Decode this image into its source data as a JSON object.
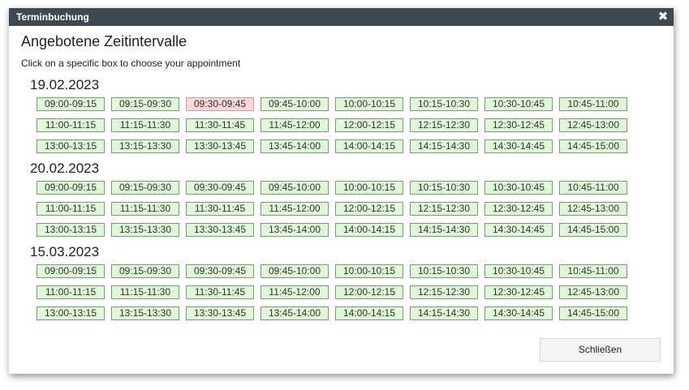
{
  "dialog": {
    "title": "Terminbuchung",
    "close_icon": "close-icon",
    "heading": "Angebotene Zeitintervalle",
    "hint": "Click on a specific box to choose your appointment",
    "close_button_label": "Schließen"
  },
  "colors": {
    "titlebar": "#3d4a54",
    "slot_available": "#dff8d8",
    "slot_available_border": "#7a9a76",
    "slot_booked": "#f9d7d7"
  },
  "days": [
    {
      "date": "19.02.2023",
      "slots": [
        {
          "label": "09:00-09:15",
          "state": "available"
        },
        {
          "label": "09:15-09:30",
          "state": "available"
        },
        {
          "label": "09:30-09:45",
          "state": "booked"
        },
        {
          "label": "09:45-10:00",
          "state": "available"
        },
        {
          "label": "10:00-10:15",
          "state": "available"
        },
        {
          "label": "10:15-10:30",
          "state": "available"
        },
        {
          "label": "10:30-10:45",
          "state": "available"
        },
        {
          "label": "10:45-11:00",
          "state": "available"
        },
        {
          "label": "11:00-11:15",
          "state": "available"
        },
        {
          "label": "11:15-11:30",
          "state": "available"
        },
        {
          "label": "11:30-11:45",
          "state": "available"
        },
        {
          "label": "11:45-12:00",
          "state": "available"
        },
        {
          "label": "12:00-12:15",
          "state": "available"
        },
        {
          "label": "12:15-12:30",
          "state": "available"
        },
        {
          "label": "12:30-12:45",
          "state": "available"
        },
        {
          "label": "12:45-13:00",
          "state": "available"
        },
        {
          "label": "13:00-13:15",
          "state": "available"
        },
        {
          "label": "13:15-13:30",
          "state": "available"
        },
        {
          "label": "13:30-13:45",
          "state": "available"
        },
        {
          "label": "13:45-14:00",
          "state": "available"
        },
        {
          "label": "14:00-14:15",
          "state": "available"
        },
        {
          "label": "14:15-14:30",
          "state": "available"
        },
        {
          "label": "14:30-14:45",
          "state": "available"
        },
        {
          "label": "14:45-15:00",
          "state": "available"
        }
      ]
    },
    {
      "date": "20.02.2023",
      "slots": [
        {
          "label": "09:00-09:15",
          "state": "available"
        },
        {
          "label": "09:15-09:30",
          "state": "available"
        },
        {
          "label": "09:30-09:45",
          "state": "available"
        },
        {
          "label": "09:45-10:00",
          "state": "available"
        },
        {
          "label": "10:00-10:15",
          "state": "available"
        },
        {
          "label": "10:15-10:30",
          "state": "available"
        },
        {
          "label": "10:30-10:45",
          "state": "available"
        },
        {
          "label": "10:45-11:00",
          "state": "available"
        },
        {
          "label": "11:00-11:15",
          "state": "available"
        },
        {
          "label": "11:15-11:30",
          "state": "available"
        },
        {
          "label": "11:30-11:45",
          "state": "available"
        },
        {
          "label": "11:45-12:00",
          "state": "available"
        },
        {
          "label": "12:00-12:15",
          "state": "available"
        },
        {
          "label": "12:15-12:30",
          "state": "available"
        },
        {
          "label": "12:30-12:45",
          "state": "available"
        },
        {
          "label": "12:45-13:00",
          "state": "available"
        },
        {
          "label": "13:00-13:15",
          "state": "available"
        },
        {
          "label": "13:15-13:30",
          "state": "available"
        },
        {
          "label": "13:30-13:45",
          "state": "available"
        },
        {
          "label": "13:45-14:00",
          "state": "available"
        },
        {
          "label": "14:00-14:15",
          "state": "available"
        },
        {
          "label": "14:15-14:30",
          "state": "available"
        },
        {
          "label": "14:30-14:45",
          "state": "available"
        },
        {
          "label": "14:45-15:00",
          "state": "available"
        }
      ]
    },
    {
      "date": "15.03.2023",
      "slots": [
        {
          "label": "09:00-09:15",
          "state": "available"
        },
        {
          "label": "09:15-09:30",
          "state": "available"
        },
        {
          "label": "09:30-09:45",
          "state": "available"
        },
        {
          "label": "09:45-10:00",
          "state": "available"
        },
        {
          "label": "10:00-10:15",
          "state": "available"
        },
        {
          "label": "10:15-10:30",
          "state": "available"
        },
        {
          "label": "10:30-10:45",
          "state": "available"
        },
        {
          "label": "10:45-11:00",
          "state": "available"
        },
        {
          "label": "11:00-11:15",
          "state": "available"
        },
        {
          "label": "11:15-11:30",
          "state": "available"
        },
        {
          "label": "11:30-11:45",
          "state": "available"
        },
        {
          "label": "11:45-12:00",
          "state": "available"
        },
        {
          "label": "12:00-12:15",
          "state": "available"
        },
        {
          "label": "12:15-12:30",
          "state": "available"
        },
        {
          "label": "12:30-12:45",
          "state": "available"
        },
        {
          "label": "12:45-13:00",
          "state": "available"
        },
        {
          "label": "13:00-13:15",
          "state": "available"
        },
        {
          "label": "13:15-13:30",
          "state": "available"
        },
        {
          "label": "13:30-13:45",
          "state": "available"
        },
        {
          "label": "13:45-14:00",
          "state": "available"
        },
        {
          "label": "14:00-14:15",
          "state": "available"
        },
        {
          "label": "14:15-14:30",
          "state": "available"
        },
        {
          "label": "14:30-14:45",
          "state": "available"
        },
        {
          "label": "14:45-15:00",
          "state": "available"
        }
      ]
    }
  ]
}
